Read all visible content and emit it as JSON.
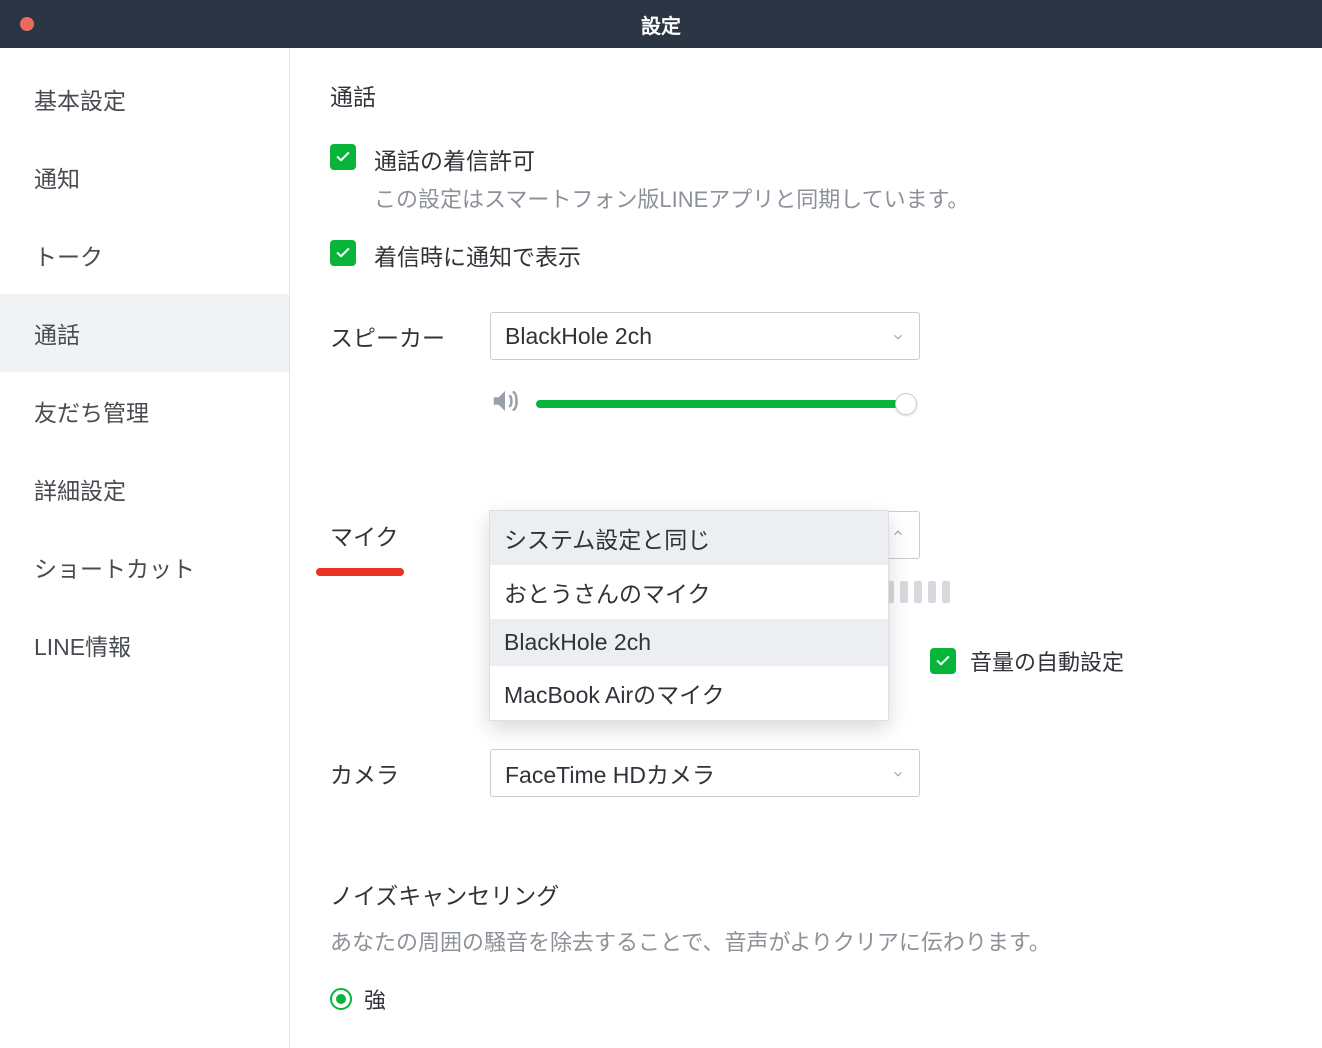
{
  "window": {
    "title": "設定"
  },
  "sidebar": {
    "items": [
      {
        "label": "基本設定"
      },
      {
        "label": "通知"
      },
      {
        "label": "トーク"
      },
      {
        "label": "通話"
      },
      {
        "label": "友だち管理"
      },
      {
        "label": "詳細設定"
      },
      {
        "label": "ショートカット"
      },
      {
        "label": "LINE情報"
      }
    ],
    "active_index": 3
  },
  "main": {
    "section_title": "通話",
    "allow_incoming": {
      "label": "通話の着信許可",
      "sub": "この設定はスマートフォン版LINEアプリと同期しています。",
      "checked": true
    },
    "notify_on_incoming": {
      "label": "着信時に通知で表示",
      "checked": true
    },
    "speaker": {
      "label": "スピーカー",
      "selected": "BlackHole 2ch",
      "volume_percent": 100
    },
    "mic": {
      "label": "マイク",
      "options": [
        "システム設定と同じ",
        "おとうさんのマイク",
        "BlackHole 2ch",
        "MacBook Airのマイク"
      ],
      "highlighted_index": 2,
      "auto_volume_label": "音量の自動設定",
      "auto_volume_checked": true
    },
    "camera": {
      "label": "カメラ",
      "selected": "FaceTime HDカメラ"
    },
    "noise_cancel": {
      "title": "ノイズキャンセリング",
      "sub": "あなたの周囲の騒音を除去することで、音声がよりクリアに伝わります。",
      "option_strong": "強"
    }
  }
}
